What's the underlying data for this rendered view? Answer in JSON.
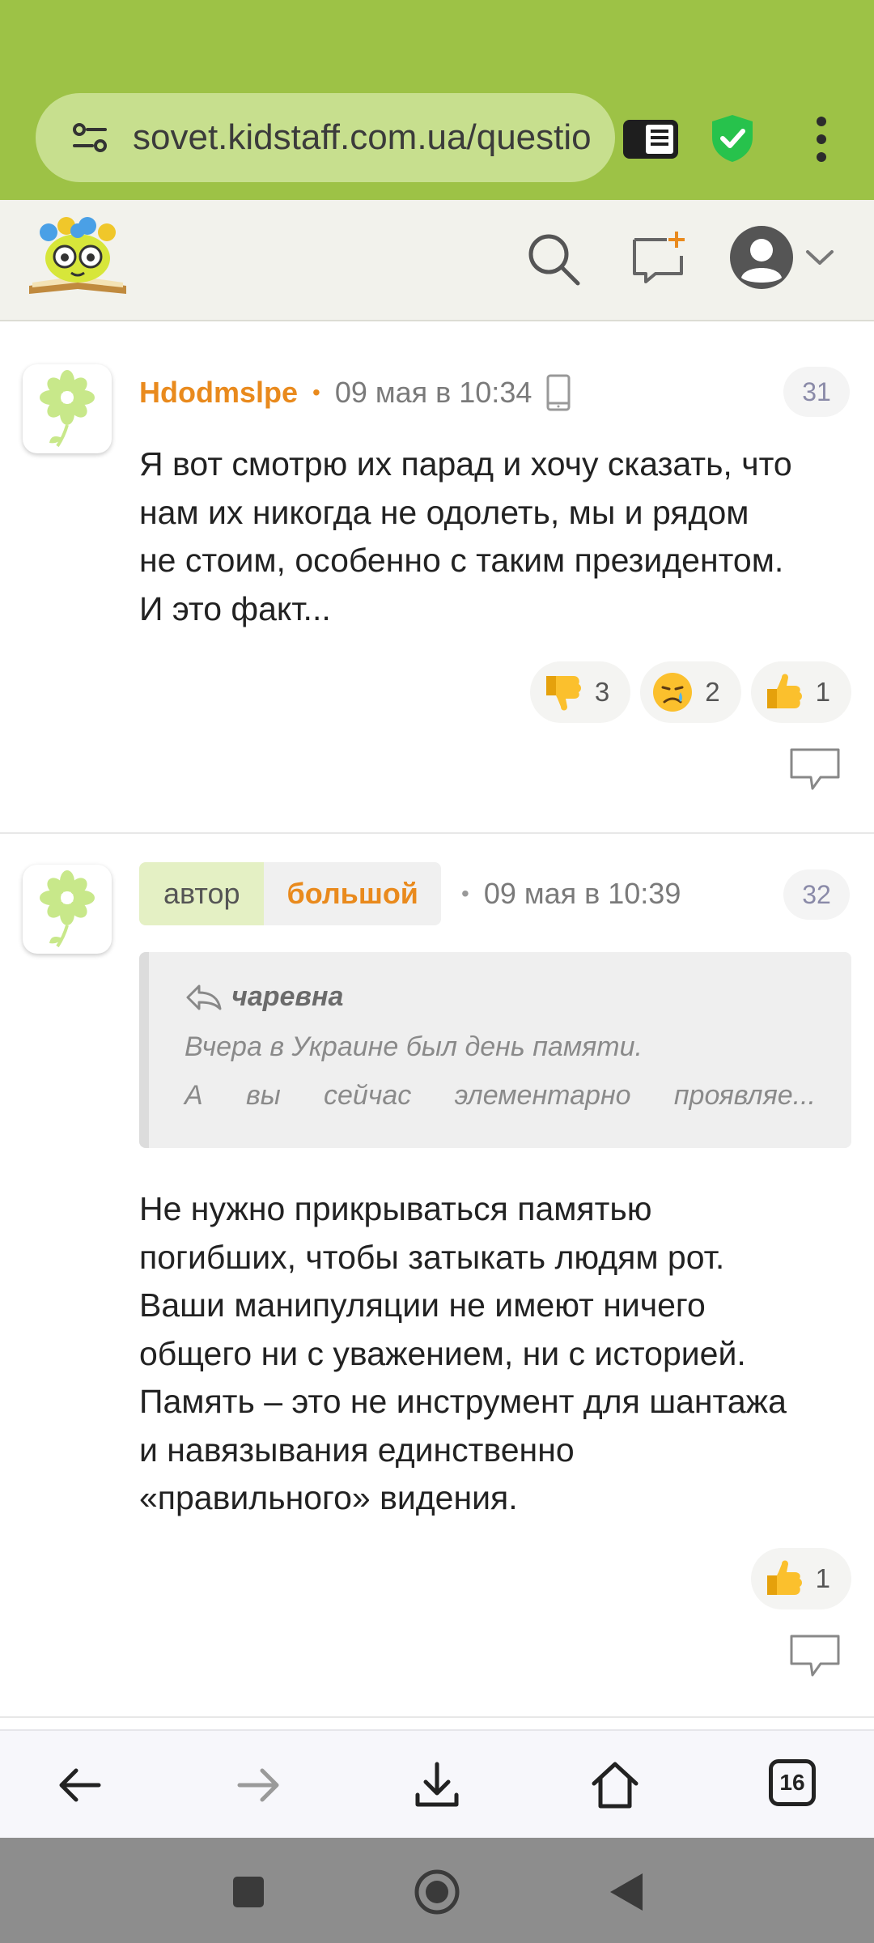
{
  "browser": {
    "url": "sovet.kidstaff.com.ua/questio",
    "tabs_count": "16"
  },
  "comments": [
    {
      "username": "Hdodmslpe",
      "date": "09 мая в 10:34",
      "number": "31",
      "text_lines": [
        "Я вот смотрю их парад и хочу сказать, что",
        "нам их никогда не одолеть, мы и рядом",
        "не стоим, особенно с таким президентом.",
        "И это факт..."
      ],
      "reactions": [
        {
          "emoji": "thumbs-down",
          "count": "3"
        },
        {
          "emoji": "crying-face",
          "count": "2"
        },
        {
          "emoji": "thumbs-up",
          "count": "1"
        }
      ]
    },
    {
      "author_label": "автор",
      "username": "большой",
      "date": "09 мая в 10:39",
      "number": "32",
      "quote": {
        "author": "чаревна",
        "line1": "Вчера в Украине был день памяти.",
        "line2_words": [
          "А",
          "вы",
          "сейчас",
          "элементарно",
          "проявляе..."
        ]
      },
      "text_lines": [
        "Не нужно прикрываться памятью",
        "погибших, чтобы затыкать людям рот.",
        "Ваши манипуляции не имеют ничего",
        "общего ни с уважением, ни с историей.",
        "Память – это не инструмент для шантажа",
        "и навязывания единственно",
        "«правильного» видения."
      ],
      "reactions": [
        {
          "emoji": "thumbs-up",
          "count": "1"
        }
      ]
    }
  ],
  "colors": {
    "chrome_green": "#9dc246",
    "accent_orange": "#e98a1d"
  }
}
